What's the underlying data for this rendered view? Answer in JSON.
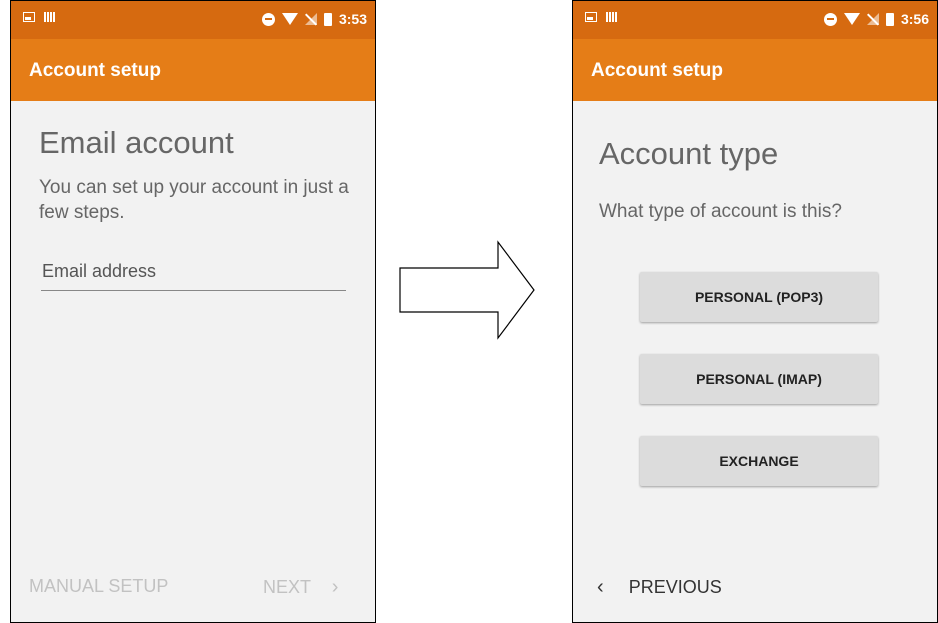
{
  "left_screen": {
    "status": {
      "time": "3:53"
    },
    "appbar_title": "Account setup",
    "heading": "Email account",
    "subtext": "You can set up your account in just a few steps.",
    "email_placeholder": "Email address",
    "manual_setup_label": "MANUAL SETUP",
    "next_label": "NEXT",
    "next_chevron": "›"
  },
  "right_screen": {
    "status": {
      "time": "3:56"
    },
    "appbar_title": "Account setup",
    "heading": "Account type",
    "question": "What type of account is this?",
    "buttons": [
      "PERSONAL (POP3)",
      "PERSONAL (IMAP)",
      "EXCHANGE"
    ],
    "previous_chevron": "‹",
    "previous_label": "PREVIOUS"
  },
  "colors": {
    "statusbar": "#d66a10",
    "appbar": "#e57d17",
    "background": "#f2f2f2",
    "button": "#dcdcdc"
  },
  "icons": [
    "gallery-icon",
    "signal-bars-icon",
    "do-not-disturb-icon",
    "wifi-icon",
    "no-sim-icon",
    "battery-icon",
    "right-arrow-icon"
  ]
}
